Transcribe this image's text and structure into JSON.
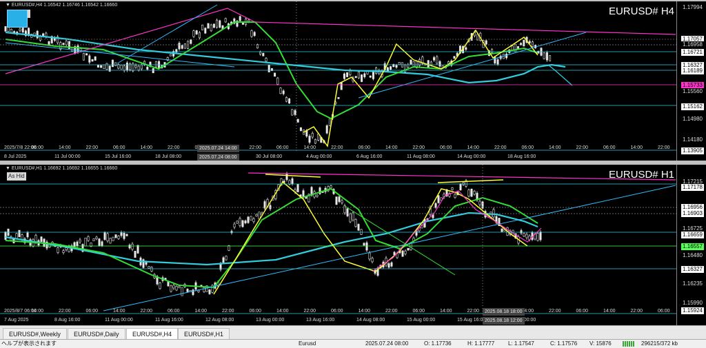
{
  "top": {
    "info": "▼ EURUSD#,H4  1.16542 1.16746 1.16542 1.16660",
    "title": "EURUSD# H4",
    "tag": "",
    "price_labels": [
      {
        "text": "1.17994",
        "bg": "#000000",
        "fg": "#dddddd"
      },
      {
        "text": "1.17057",
        "bg": "#ffffff",
        "fg": "#000000"
      },
      {
        "text": "1.16958",
        "bg": "#000000",
        "fg": "#dddddd"
      },
      {
        "text": "1.16721",
        "bg": "#ffffff",
        "fg": "#000000"
      },
      {
        "text": "1.16327",
        "bg": "#ffffff",
        "fg": "#000000"
      },
      {
        "text": "1.16189",
        "bg": "#ffffff",
        "fg": "#000000"
      },
      {
        "text": "1.15733",
        "bg": "#ff33cc",
        "fg": "#000000"
      },
      {
        "text": "1.15560",
        "bg": "#000000",
        "fg": "#dddddd"
      },
      {
        "text": "1.15162",
        "bg": "#ffffff",
        "fg": "#000000"
      },
      {
        "text": "1.14980",
        "bg": "#000000",
        "fg": "#dddddd"
      },
      {
        "text": "1.14180",
        "bg": "#000000",
        "fg": "#dddddd"
      },
      {
        "text": "1.13905",
        "bg": "#ffffff",
        "fg": "#000000"
      }
    ],
    "time_labels": [
      "2025/7/8 22:00",
      "06:00",
      "14:00",
      "22:00",
      "06:00",
      "14:00",
      "22:00",
      "06:00",
      "14:00",
      "22:00",
      "06:00",
      "14:00",
      "22:00",
      "06:00",
      "14:00",
      "22:00",
      "06:00",
      "14:00",
      "22:00",
      "06:00",
      "14:00",
      "22:00",
      "06:00",
      "14:00",
      "22:00"
    ],
    "time_labels_row2": [
      "8 Jul 2025",
      "11 Jul 00:00",
      "15 Jul 16:00",
      "18 Jul 08:00",
      "25 Jul 16:00",
      "30 Jul 08:00",
      "4 Aug 00:00",
      "6 Aug 16:00",
      "11 Aug 08:00",
      "14 Aug 00:00",
      "18 Aug 16:00"
    ],
    "highlight_1": "2025.07.24 14:00",
    "highlight_2": "2025.07.24 08:00"
  },
  "bottom": {
    "info": "▼ EURUSD#,H1  1.16692 1.16692 1.16655 1.16660",
    "title": "EURUSD# H1",
    "tag": "As Hid",
    "price_labels": [
      {
        "text": "1.17215",
        "bg": "#000000",
        "fg": "#dddddd"
      },
      {
        "text": "1.17178",
        "bg": "#ffffff",
        "fg": "#000000"
      },
      {
        "text": "1.16956",
        "bg": "#ffffff",
        "fg": "#000000"
      },
      {
        "text": "1.16903",
        "bg": "#ffffff",
        "fg": "#000000"
      },
      {
        "text": "1.16725",
        "bg": "#000000",
        "fg": "#dddddd"
      },
      {
        "text": "1.16659",
        "bg": "#ffffff",
        "fg": "#000000"
      },
      {
        "text": "1.16557",
        "bg": "#55ff55",
        "fg": "#000000"
      },
      {
        "text": "1.16480",
        "bg": "#000000",
        "fg": "#dddddd"
      },
      {
        "text": "1.16327",
        "bg": "#ffffff",
        "fg": "#000000"
      },
      {
        "text": "1.16235",
        "bg": "#000000",
        "fg": "#dddddd"
      },
      {
        "text": "1.15990",
        "bg": "#000000",
        "fg": "#dddddd"
      },
      {
        "text": "1.15924",
        "bg": "#ffffff",
        "fg": "#000000"
      }
    ],
    "time_labels": [
      "2025/8/7 06:00",
      "14:00",
      "22:00",
      "06:00",
      "14:00",
      "22:00",
      "06:00",
      "14:00",
      "22:00",
      "06:00",
      "14:00",
      "22:00",
      "06:00",
      "14:00",
      "22:00",
      "06:00",
      "14:00",
      "22:00",
      "06:00",
      "14:00",
      "22:00",
      "06:00",
      "14:00",
      "22:00",
      "06:00"
    ],
    "time_labels_row2": [
      "7 Aug 2025",
      "8 Aug 16:00",
      "11 Aug 00:00",
      "11 Aug 16:00",
      "12 Aug 08:00",
      "13 Aug 00:00",
      "13 Aug 16:00",
      "14 Aug 08:00",
      "15 Aug 00:00",
      "15 Aug 16:00",
      "19 Aug 00:00"
    ],
    "highlight_1": "2025.08.18 18:00",
    "highlight_2": "2025.08.18 12:00"
  },
  "tabs": [
    "EURUSD#,Weekly",
    "EURUSD#,Daily",
    "EURUSD#,H4",
    "EURUSD#,H1"
  ],
  "active_tab": 2,
  "status": {
    "help": "ヘルプが表示されます",
    "symbol": "Eurusd",
    "datetime": "2025.07.24 08:00",
    "open": "O: 1.17736",
    "high": "H: 1.17777",
    "low": "L: 1.17547",
    "close": "C: 1.17576",
    "volume": "V: 15876",
    "traffic": "296215/372 kb"
  },
  "colors": {
    "ma_fast": "#ffff33",
    "ma_mid": "#33dd33",
    "ma_slow": "#33ccdd",
    "trend": "#ff33cc",
    "line": "#33bbff"
  }
}
